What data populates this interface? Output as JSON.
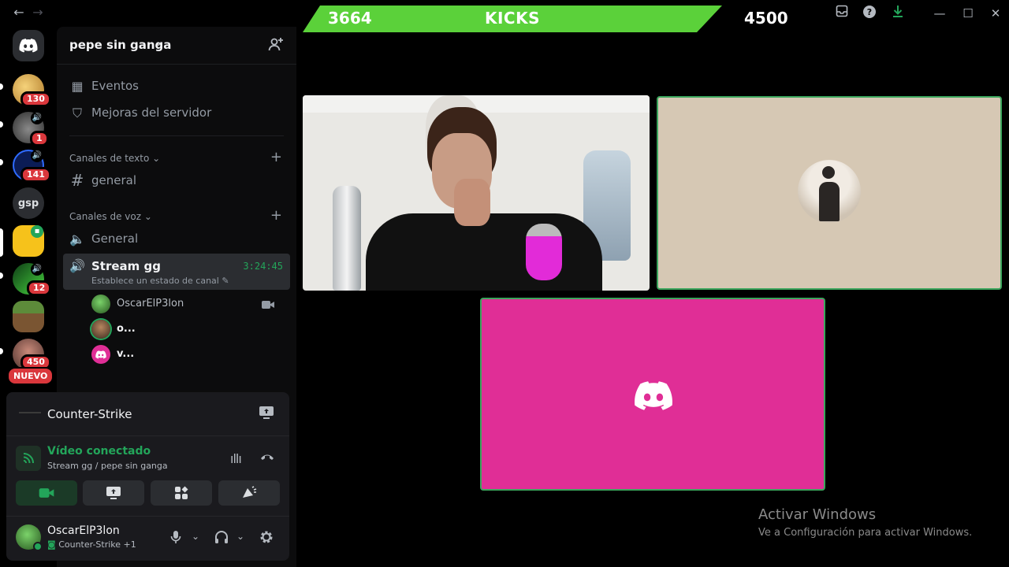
{
  "overlay": {
    "current": "3664",
    "label": "KICKS",
    "goal": "4500"
  },
  "guilds": {
    "badges": [
      "130",
      "1",
      "141",
      "12",
      "450"
    ],
    "gsp_label": "gsp",
    "new_label": "NUEVO"
  },
  "server": {
    "name": "pepe sin ganga",
    "events": "Eventos",
    "boosts": "Mejoras del servidor",
    "text_category": "Canales de texto",
    "text_channel": "general",
    "voice_category": "Canales de voz",
    "voice_channel_1": "General",
    "active_channel": "Stream gg",
    "active_timer": "3:24:45",
    "status_hint": "Establece un estado de canal",
    "participants": [
      "OscarElP3lon",
      "o...",
      "v..."
    ]
  },
  "panel": {
    "activity": "Counter-Strike",
    "connection_status": "Vídeo conectado",
    "connection_detail": "Stream gg / pepe sin ganga",
    "user_name": "OscarElP3lon",
    "user_activity": "Counter-Strike +1"
  },
  "watermark": {
    "line1": "Activar Windows",
    "line2": "Ve a Configuración para activar Windows."
  },
  "colors": {
    "accent_green": "#23a55a",
    "kicks_bar": "#5bd13a",
    "discord_tile": "#e02e96",
    "speaking_border": "#3ba55c"
  }
}
